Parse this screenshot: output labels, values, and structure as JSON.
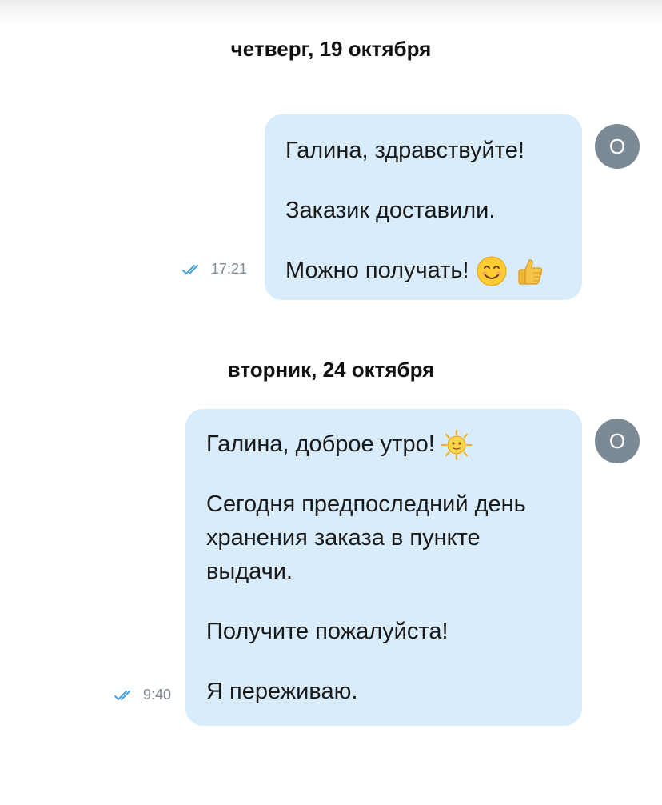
{
  "chat": {
    "groups": [
      {
        "date": "четверг, 19 октября",
        "message": {
          "lines": [
            "Галина, здравствуйте!",
            "Заказик доставили.",
            "Можно получать!"
          ],
          "emoji": [
            "smiling-face-icon",
            "thumbs-up-icon"
          ],
          "time": "17:21",
          "status": "read-double-check-icon"
        },
        "avatar": "O"
      },
      {
        "date": "вторник, 24 октября",
        "message": {
          "lines": [
            "Галина, доброе утро!",
            "Сегодня предпоследний день хранения заказа в пункте выдачи.",
            "Получите пожалуйста!",
            "Я переживаю."
          ],
          "emoji": [
            "sun-with-face-icon"
          ],
          "time": "9:40",
          "status": "read-double-check-icon"
        },
        "avatar": "O"
      }
    ],
    "colors": {
      "bubble": "#d8ecfb",
      "avatar": "#7c8a96",
      "read_ticks": "#4a9fe0",
      "meta_text": "#7d8a96"
    }
  }
}
